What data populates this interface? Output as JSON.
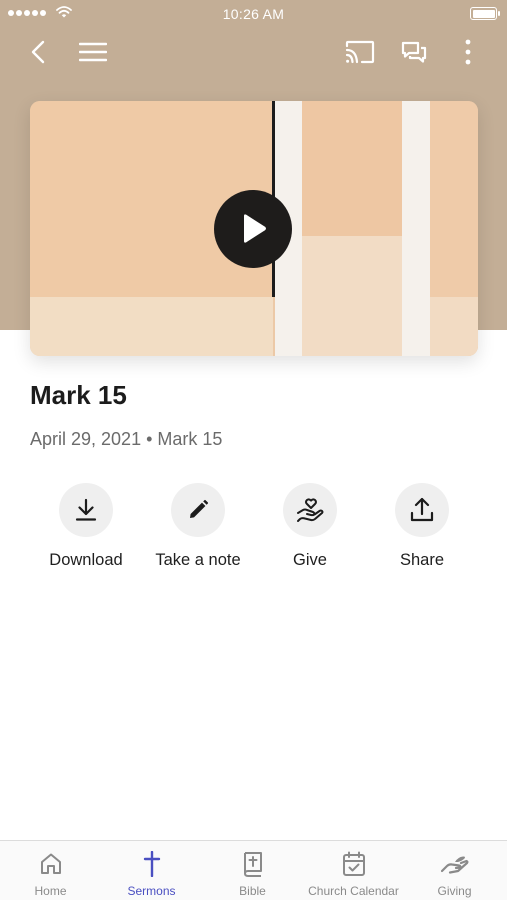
{
  "status_bar": {
    "time": "10:26 AM"
  },
  "top_nav": {
    "icons": [
      "chevron-left-icon",
      "menu-icon",
      "cast-icon",
      "chat-bubbles-icon",
      "more-vertical-icon"
    ]
  },
  "sermon": {
    "title": "Mark 15",
    "date": "April 29, 2021",
    "separator": "•",
    "passage": "Mark 15"
  },
  "actions": [
    {
      "label": "Download",
      "icon": "download-icon"
    },
    {
      "label": "Take a note",
      "icon": "pencil-icon"
    },
    {
      "label": "Give",
      "icon": "heart-hand-icon"
    },
    {
      "label": "Share",
      "icon": "share-icon"
    }
  ],
  "tabs": [
    {
      "label": "Home",
      "icon": "home-icon"
    },
    {
      "label": "Sermons",
      "icon": "cross-icon",
      "active": true
    },
    {
      "label": "Bible",
      "icon": "bible-icon"
    },
    {
      "label": "Church Calendar",
      "icon": "calendar-icon"
    },
    {
      "label": "Giving",
      "icon": "giving-hand-icon"
    }
  ],
  "colors": {
    "header_background": "#c3ae96",
    "accent": "#4a4fc1",
    "action_circle": "#efefef",
    "play_button": "#1e1c1b"
  }
}
